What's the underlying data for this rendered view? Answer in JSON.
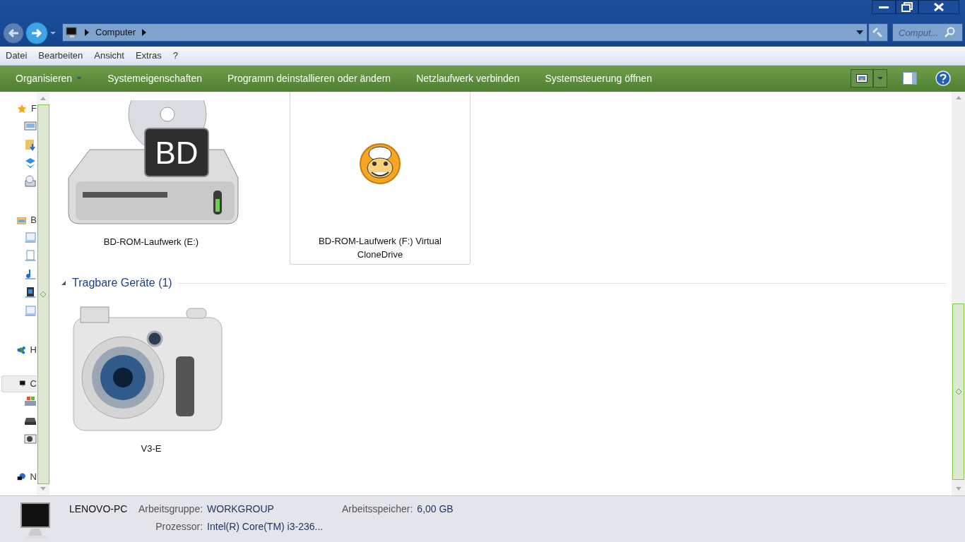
{
  "address": {
    "breadcrumb": [
      "Computer"
    ]
  },
  "search": {
    "placeholder": "Comput..."
  },
  "menu": [
    "Datei",
    "Bearbeiten",
    "Ansicht",
    "Extras",
    "?"
  ],
  "commands": [
    {
      "label": "Organisieren",
      "dropdown": true
    },
    {
      "label": "Systemeigenschaften",
      "dropdown": false
    },
    {
      "label": "Programm deinstallieren oder ändern",
      "dropdown": false
    },
    {
      "label": "Netzlaufwerk verbinden",
      "dropdown": false
    },
    {
      "label": "Systemsteuerung öffnen",
      "dropdown": false
    }
  ],
  "nav": [
    {
      "kind": "favorites",
      "label": "F",
      "selected": false,
      "children": [
        {
          "kind": "desktop",
          "selected": false
        },
        {
          "kind": "downloads",
          "selected": false
        },
        {
          "kind": "box",
          "selected": false
        },
        {
          "kind": "recent",
          "selected": false
        }
      ]
    },
    {
      "kind": "libraries",
      "label": "B",
      "selected": false,
      "children": [
        {
          "kind": "pictures",
          "selected": false
        },
        {
          "kind": "documents",
          "selected": false
        },
        {
          "kind": "music",
          "selected": false
        },
        {
          "kind": "videos",
          "selected": false
        },
        {
          "kind": "pictures",
          "selected": false
        }
      ]
    },
    {
      "kind": "homegroup",
      "label": "H",
      "selected": false
    },
    {
      "kind": "computer",
      "label": "C",
      "selected": true,
      "children": [
        {
          "kind": "windows-drive",
          "selected": false
        },
        {
          "kind": "drive",
          "selected": false
        },
        {
          "kind": "camera",
          "selected": false
        }
      ]
    },
    {
      "kind": "network",
      "label": "N",
      "selected": false
    }
  ],
  "sections": [
    {
      "items": [
        {
          "kind": "bd-drive",
          "label": "BD-ROM-Laufwerk (E:)",
          "badge": "BD",
          "hovered": false
        },
        {
          "kind": "virtual-drive",
          "label": "BD-ROM-Laufwerk (F:) Virtual CloneDrive",
          "hovered": true
        }
      ]
    },
    {
      "title": "Tragbare Geräte (1)",
      "expanded": true,
      "items": [
        {
          "kind": "camera",
          "label": "V3-E",
          "hovered": false
        }
      ]
    }
  ],
  "details": {
    "name": "LENOVO-PC",
    "fields": [
      {
        "label": "Arbeitsgruppe:",
        "value": "WORKGROUP"
      },
      {
        "label": "Arbeitsspeicher:",
        "value": "6,00 GB"
      },
      {
        "label": "Prozessor:",
        "value": "Intel(R) Core(TM) i3-236..."
      }
    ]
  }
}
